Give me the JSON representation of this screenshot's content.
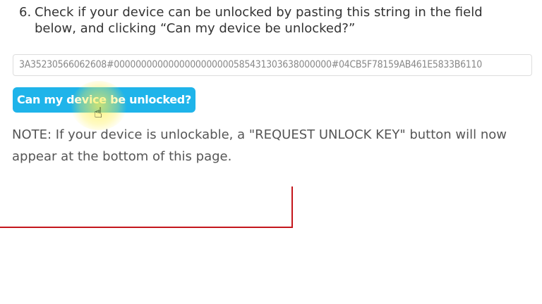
{
  "step": {
    "number": "6.",
    "text": "Check if your device can be unlocked by pasting this string in the field below, and clicking “Can my device be unlocked?”"
  },
  "unlock_field": {
    "value": "3A3523056606260 8#0000000000000000000000585431303638000000#04CB5F78159AB461E5833B6110"
  },
  "unlock_button": {
    "label": "Can my device be unlocked?"
  },
  "note": "NOTE: If your device is unlockable, a \"REQUEST UNLOCK KEY\" button will now appear at the bottom of this page.",
  "colors": {
    "button": "#1fb4ea",
    "annotation_line": "#c4161c"
  }
}
